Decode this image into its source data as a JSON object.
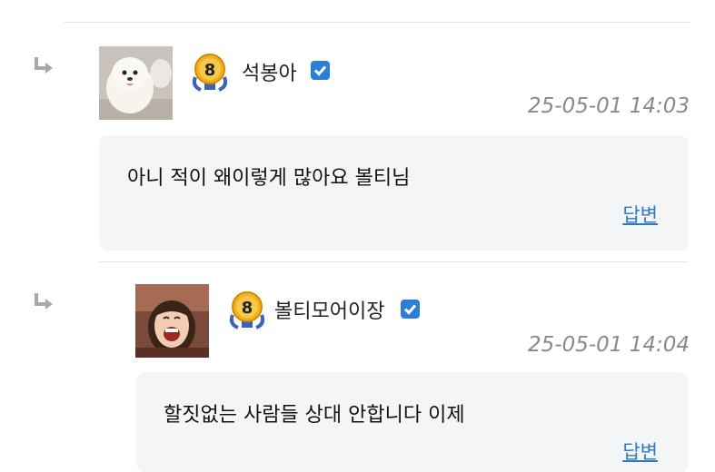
{
  "comments": [
    {
      "nickname": "석봉아",
      "level": "8",
      "timestamp": "25-05-01 14:03",
      "content": "아니 적이 왜이렇게 많아요 볼티님",
      "reply_label": "답변",
      "avatar": "white-pomeranian-photo"
    },
    {
      "nickname": "볼티모어이장",
      "level": "8",
      "timestamp": "25-05-01 14:04",
      "content": "할짓없는 사람들 상대 안합니다 이제",
      "reply_label": "답변",
      "avatar": "laughing-woman-photo"
    }
  ],
  "icons": {
    "reply": "reply-arrow-icon",
    "verified": "check-badge-icon",
    "level": "level-medal-icon"
  },
  "colors": {
    "accent": "#2d7fd6",
    "link": "#2f78c4",
    "bubble_bg": "#f4f5f7",
    "medal_gold": "#f2b01e"
  }
}
